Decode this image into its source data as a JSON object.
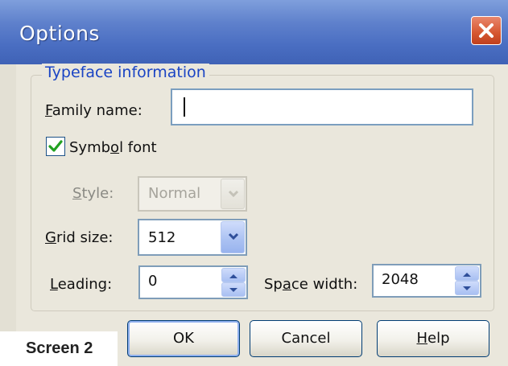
{
  "window": {
    "title": "Options",
    "close_icon": "close-icon"
  },
  "group": {
    "title": "Typeface information"
  },
  "family_name": {
    "label_pre": "",
    "label_key": "F",
    "label_post": "amily name:",
    "value": ""
  },
  "symbol_font": {
    "label_pre": "Symb",
    "label_key": "o",
    "label_post": "l font",
    "checked": true
  },
  "style": {
    "label_pre": "",
    "label_key": "S",
    "label_post": "tyle:",
    "value": "Normal",
    "disabled": true
  },
  "grid_size": {
    "label_pre": "",
    "label_key": "G",
    "label_post": "rid size:",
    "value": "512"
  },
  "leading": {
    "label_pre": "",
    "label_key": "L",
    "label_post": "eading:",
    "value": "0"
  },
  "space_width": {
    "label_pre": "Sp",
    "label_key": "a",
    "label_post": "ce width:",
    "value": "2048"
  },
  "buttons": {
    "ok": "OK",
    "cancel": "Cancel",
    "help_key": "H",
    "help_post": "elp"
  },
  "caption": "Screen 2"
}
